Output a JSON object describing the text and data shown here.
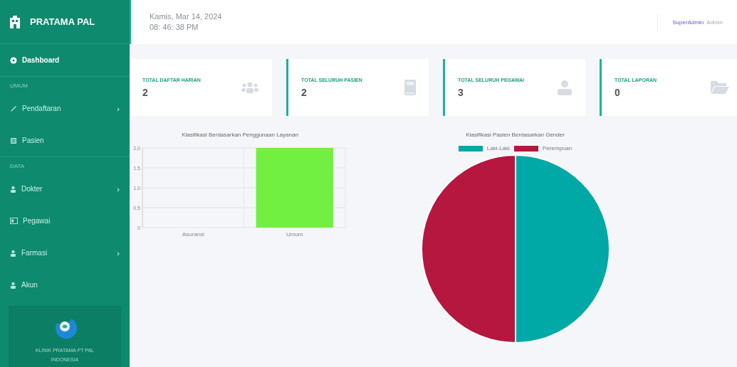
{
  "sidebar": {
    "brand": "PRATAMA PAL",
    "items": [
      {
        "kind": "item",
        "label": "Dashboard",
        "selected": true
      },
      {
        "kind": "section",
        "label": "UMUM"
      },
      {
        "kind": "item",
        "label": "Pendaftaran",
        "selected": false,
        "chevron": "›"
      },
      {
        "kind": "item",
        "label": "Pasien",
        "selected": false
      },
      {
        "kind": "section",
        "label": "DATA"
      },
      {
        "kind": "item",
        "label": "Dokter",
        "selected": false,
        "chevron": "›"
      },
      {
        "kind": "item",
        "label": "Pegawai",
        "selected": false
      },
      {
        "kind": "item",
        "label": "Farmasi",
        "selected": false,
        "chevron": "›"
      },
      {
        "kind": "item",
        "label": "Akun",
        "selected": false
      }
    ],
    "footer": "KLINIK PRATAMA PT PAL INDONESIA"
  },
  "header": {
    "date": "Kamis, Mar 14, 2024",
    "time": "08: 46: 38 PM",
    "user": "SuperAdmin",
    "role": "Admin"
  },
  "cards": [
    {
      "label": "TOTAL DAFTAR HARIAN",
      "value": "2"
    },
    {
      "label": "TOTAL SELURUH PASIEN",
      "value": "2"
    },
    {
      "label": "TOTAL SELURUH PEGAWAI",
      "value": "3"
    },
    {
      "label": "TOTAL LAPORAN",
      "value": "0"
    }
  ],
  "charts": [
    {
      "chart_data": {
        "type": "bar",
        "title": "Klasifikasi Berdasarkan Penggunaan Layanan",
        "categories": [
          "Asuransi",
          "Umum"
        ],
        "series": [
          {
            "color": "#72f042",
            "values": [
              0,
              2
            ]
          }
        ],
        "ylim": [
          0,
          2
        ],
        "yticks": [
          0,
          0.5,
          {
            "value": 1,
            "label": "1.0"
          },
          1.5,
          {
            "value": 2,
            "label": "2.0"
          }
        ],
        "grid": true
      }
    },
    {
      "chart_data": {
        "type": "pie",
        "title": "Klasifikasi Pasien Berdasarkan Gender",
        "categories": [
          "Laki-Laki",
          "Perempuan"
        ],
        "values": [
          50,
          50
        ],
        "colors": [
          "#00a9a5",
          "#b5173f"
        ],
        "legend": true
      }
    }
  ]
}
